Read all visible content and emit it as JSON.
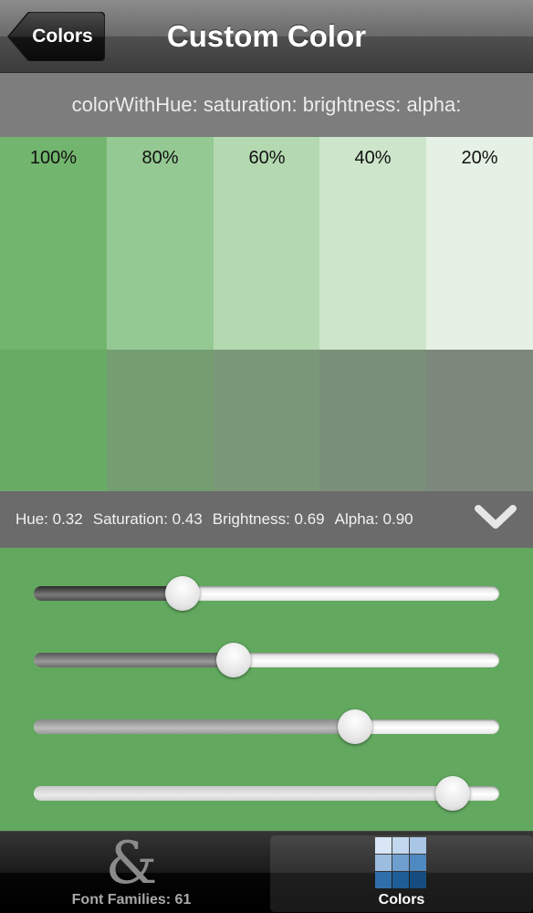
{
  "nav": {
    "back_label": "Colors",
    "title": "Custom Color"
  },
  "method_header": "colorWithHue: saturation: brightness: alpha:",
  "swatches": [
    {
      "label": "100%",
      "top_color": "#72b56e",
      "bottom_color": "#68ab64"
    },
    {
      "label": "80%",
      "top_color": "#95c993",
      "bottom_color": "#749e72"
    },
    {
      "label": "60%",
      "top_color": "#b4d9b1",
      "bottom_color": "#7b977a"
    },
    {
      "label": "40%",
      "top_color": "#cde5cb",
      "bottom_color": "#7a8f79"
    },
    {
      "label": "20%",
      "top_color": "#e5f1e4",
      "bottom_color": "#7b887b"
    }
  ],
  "info": {
    "hue": "Hue: 0.32",
    "saturation": "Saturation: 0.43",
    "brightness": "Brightness: 0.69",
    "alpha": "Alpha: 0.90"
  },
  "sliders": [
    {
      "name": "hue",
      "value": 0.32
    },
    {
      "name": "saturation",
      "value": 0.43
    },
    {
      "name": "brightness",
      "value": 0.69
    },
    {
      "name": "alpha",
      "value": 0.9
    }
  ],
  "panel_color": "#62a85f",
  "tabs": [
    {
      "label": "Font Families: 61",
      "icon": "ampersand-icon",
      "selected": false
    },
    {
      "label": "Colors",
      "icon": "color-grid-icon",
      "selected": true
    }
  ]
}
